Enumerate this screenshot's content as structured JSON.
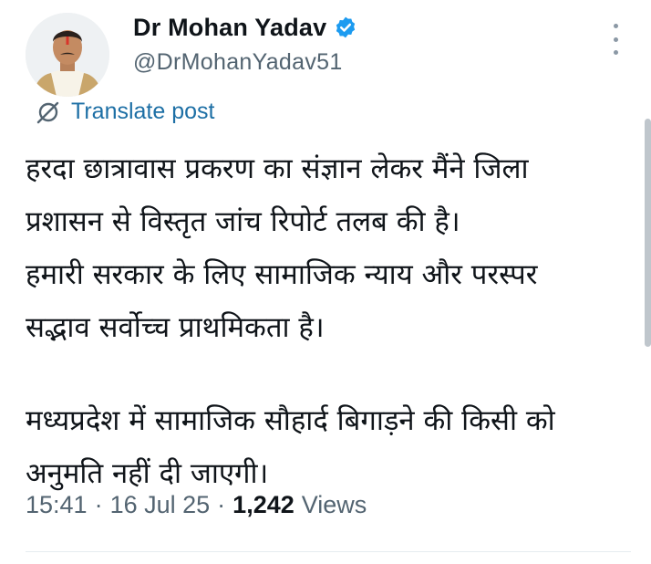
{
  "author": {
    "display_name": "Dr Mohan Yadav",
    "handle": "@DrMohanYadav51",
    "verified": true
  },
  "translate": {
    "label": "Translate post",
    "icon": "globe-slash-icon"
  },
  "post": {
    "paragraph_1": "हरदा छात्रावास प्रकरण का संज्ञान लेकर मैंने जिला\nप्रशासन से विस्तृत जांच रिपोर्ट तलब की है।\nहमारी सरकार के लिए सामाजिक न्याय और परस्पर\nसद्भाव सर्वोच्च प्राथमिकता है।",
    "paragraph_2": "मध्यप्रदेश में सामाजिक सौहार्द बिगाड़ने की किसी को\nअनुमति नहीं दी जाएगी।"
  },
  "meta": {
    "time": "15:41",
    "separator": "·",
    "date": "16 Jul 25",
    "views_count": "1,242",
    "views_label": "Views"
  },
  "colors": {
    "verified_badge": "#1d9bf0",
    "link": "#1d6fa5",
    "secondary_text": "#536471"
  }
}
